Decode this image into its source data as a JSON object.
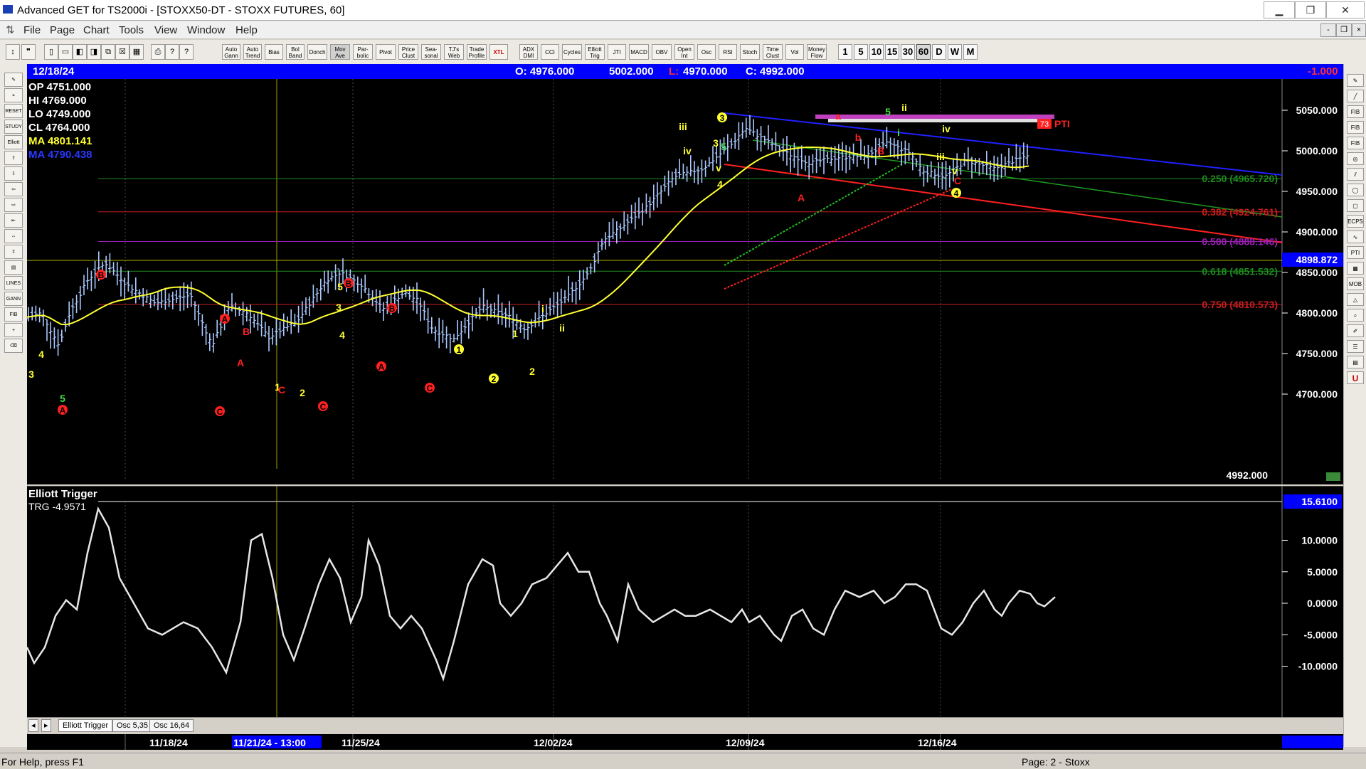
{
  "window": {
    "title": "Advanced GET for TS2000i - [STOXX50-DT - STOXX FUTURES, 60]",
    "minimize": "▁",
    "restore": "❐",
    "close": "✕"
  },
  "menu": [
    "File",
    "Page",
    "Chart",
    "Tools",
    "View",
    "Window",
    "Help"
  ],
  "mdi": {
    "minimize": "-",
    "restore": "❐",
    "close": "×"
  },
  "toolbar": {
    "studies": [
      "Auto Gann",
      "Auto Trend",
      "Bias",
      "Bol Band",
      "Donch",
      "Mov Ave",
      "Par-bolic",
      "Pivot",
      "Price Clust",
      "Sea-sonal",
      "TJ's Web",
      "Trade Profile",
      "XTL"
    ],
    "studies2": [
      "ADX DMI",
      "CCI",
      "Cycles",
      "Elliott Trig",
      "JTI",
      "MACD",
      "OBV",
      "Open Int",
      "Osc",
      "RSI",
      "Stoch",
      "Time Clust",
      "Vol",
      "Money Flow"
    ],
    "periods": [
      "1",
      "5",
      "10",
      "15",
      "30",
      "60",
      "D",
      "W",
      "M"
    ],
    "selected_period": "60"
  },
  "left_tools": [
    "RESET",
    "STUDY",
    "Elliott",
    "LINES",
    "GANN",
    "FIB"
  ],
  "right_tools": [
    "FIB RET",
    "FIB EXT",
    "FIB TIME",
    "ECPS",
    "PTI",
    "MOB"
  ],
  "header": {
    "date": "12/18/24",
    "open": "O: 4976.000",
    "high": "5002.000",
    "low_label": "L:",
    "low": "4970.000",
    "close": "C: 4992.000",
    "change": "-1.000"
  },
  "ohlc": {
    "op": "OP  4751.000",
    "hi": "HI   4769.000",
    "lo": "LO  4749.000",
    "cl": "CL  4764.000",
    "ma1": "MA  4801.141",
    "ma2": "MA  4790.438"
  },
  "price_axis": [
    "5050.000",
    "5000.000",
    "4950.000",
    "4900.000",
    "4850.000",
    "4800.000",
    "4750.000",
    "4700.000"
  ],
  "price_marker": "4898.872",
  "last_price": "4992.000",
  "fib": [
    {
      "label": "0.250 (4965.720)",
      "color": "#1e8b1e"
    },
    {
      "label": "0.382 (4924.761)",
      "color": "#c81e1e"
    },
    {
      "label": "0.500 (4888.146)",
      "color": "#9b1eb4"
    },
    {
      "label": "0.618 (4851.532)",
      "color": "#1e8b1e"
    },
    {
      "label": "0.750 (4810.573)",
      "color": "#c81e1e"
    }
  ],
  "pti": {
    "value": "73",
    "label": "PTI"
  },
  "oscillator": {
    "title": "Elliott Trigger",
    "trg": "TRG -4.9571",
    "current": "15.6100",
    "axis": [
      "10.0000",
      "5.0000",
      "0.0000",
      "-5.0000",
      "-10.0000"
    ]
  },
  "tabs": [
    "Elliott Trigger",
    "Osc 5,35",
    "Osc 16,64"
  ],
  "dates": [
    "11/18/24",
    "11/21/24 - 13:00",
    "11/25/24",
    "12/02/24",
    "12/09/24",
    "12/16/24"
  ],
  "status": {
    "help": "For Help, press F1",
    "page": "Page: 2 - Stoxx"
  },
  "waves": [
    {
      "t": "4",
      "c": "y"
    },
    {
      "t": "3",
      "c": "y"
    },
    {
      "t": "5",
      "c": "g"
    },
    {
      "t": "A",
      "c": "r",
      "o": 1
    },
    {
      "t": "B",
      "c": "r",
      "o": 1
    },
    {
      "t": "A",
      "c": "r",
      "o": 1
    },
    {
      "t": "B",
      "c": "r"
    },
    {
      "t": "A",
      "c": "r"
    },
    {
      "t": "C",
      "c": "r",
      "o": 1
    },
    {
      "t": "1",
      "c": "y"
    },
    {
      "t": "C",
      "c": "r"
    },
    {
      "t": "B",
      "c": "r",
      "o": 1
    },
    {
      "t": "2",
      "c": "y"
    },
    {
      "t": "C",
      "c": "r",
      "o": 1
    },
    {
      "t": "5",
      "c": "y"
    },
    {
      "t": "3",
      "c": "y"
    },
    {
      "t": "4",
      "c": "y"
    },
    {
      "t": "B",
      "c": "r",
      "o": 1
    },
    {
      "t": "A",
      "c": "r",
      "o": 1
    },
    {
      "t": "C",
      "c": "r",
      "o": 1
    },
    {
      "t": "1",
      "c": "y",
      "o": 1
    },
    {
      "t": "2",
      "c": "y",
      "o": 1
    },
    {
      "t": "1",
      "c": "y"
    },
    {
      "t": "2",
      "c": "y"
    },
    {
      "t": "i",
      "c": "y"
    },
    {
      "t": "ii",
      "c": "y"
    },
    {
      "t": "iii",
      "c": "y"
    },
    {
      "t": "iv",
      "c": "y"
    },
    {
      "t": "3",
      "c": "y",
      "o": 1
    },
    {
      "t": "5",
      "c": "g"
    },
    {
      "t": "3",
      "c": "y"
    },
    {
      "t": "v",
      "c": "y"
    },
    {
      "t": "4",
      "c": "y"
    },
    {
      "t": "a",
      "c": "r"
    },
    {
      "t": "A",
      "c": "r"
    },
    {
      "t": "b",
      "c": "r"
    },
    {
      "t": "B",
      "c": "r"
    },
    {
      "t": "5",
      "c": "g"
    },
    {
      "t": "ii",
      "c": "y"
    },
    {
      "t": "i",
      "c": "g"
    },
    {
      "t": "iv",
      "c": "y"
    },
    {
      "t": "iii",
      "c": "y"
    },
    {
      "t": "v",
      "c": "y"
    },
    {
      "t": "C",
      "c": "r"
    },
    {
      "t": "4",
      "c": "y",
      "o": 1
    }
  ]
}
